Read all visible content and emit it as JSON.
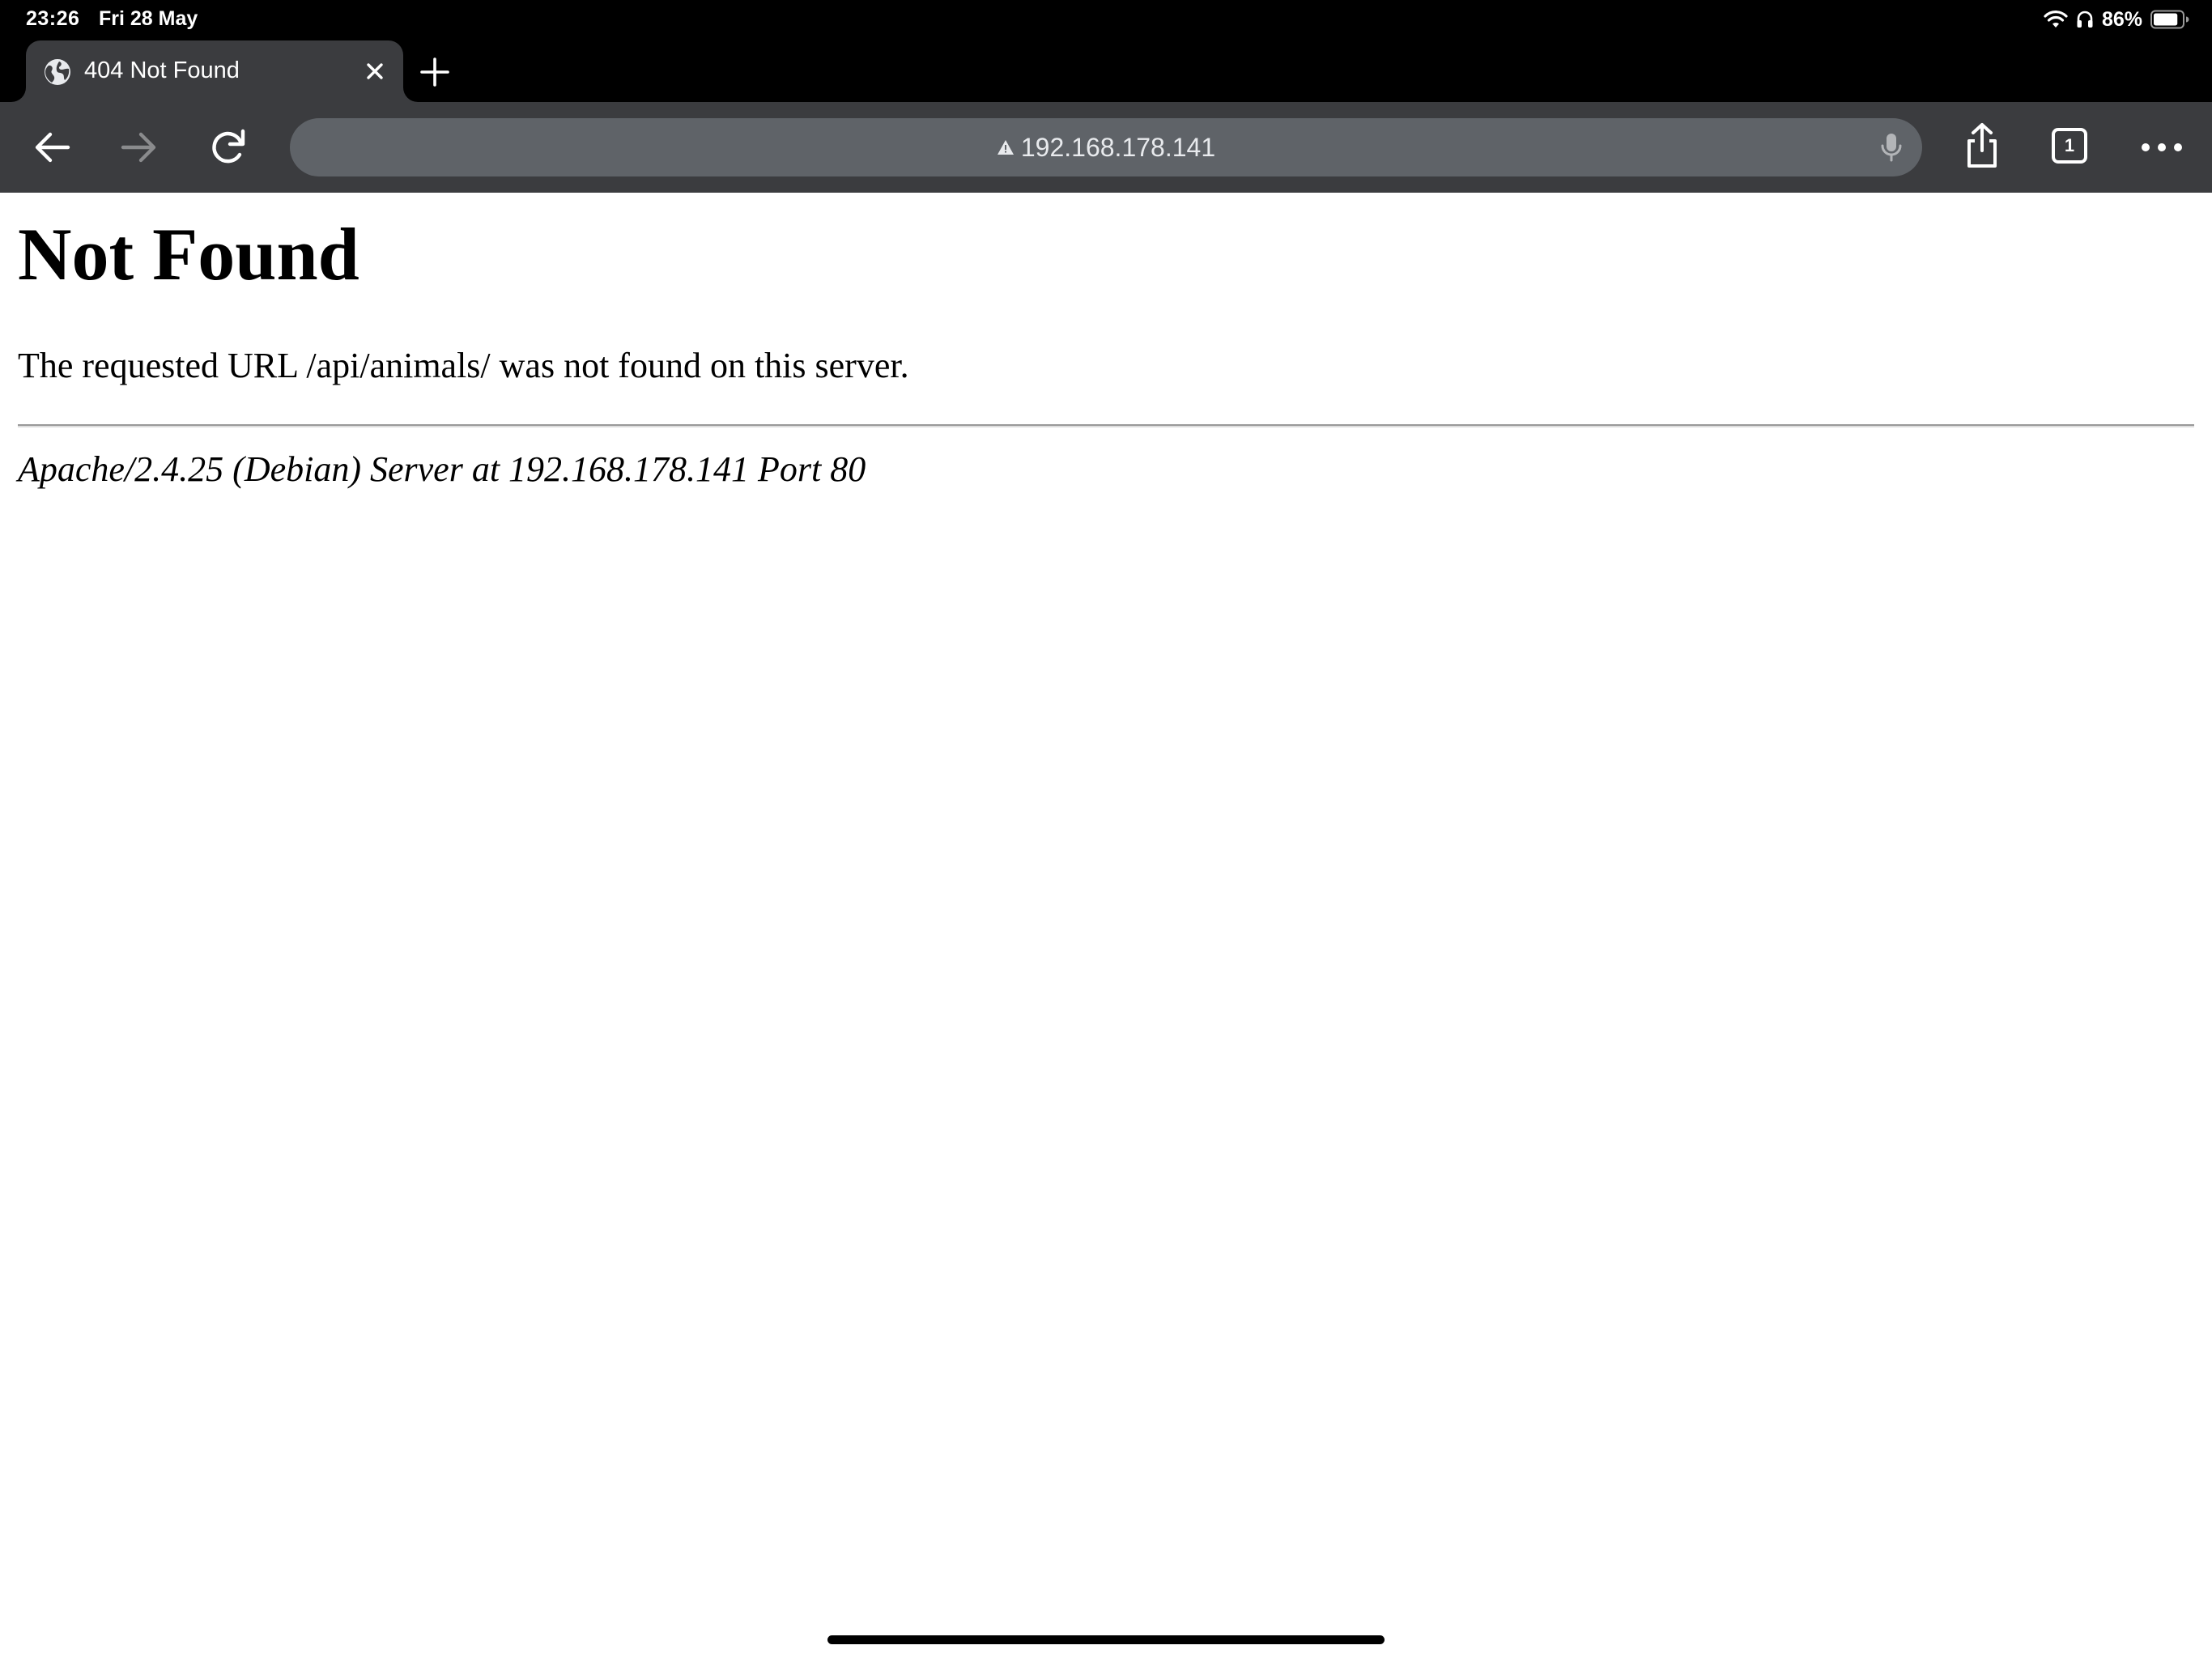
{
  "status_bar": {
    "time": "23:26",
    "date": "Fri 28 May",
    "battery_percent": "86%",
    "battery_level": 0.86,
    "icons": [
      "wifi-icon",
      "headphones-icon",
      "battery-icon"
    ]
  },
  "tabs": [
    {
      "title": "404 Not Found",
      "favicon": "globe-icon",
      "active": true
    }
  ],
  "toolbar": {
    "back_icon": "arrow-left-icon",
    "forward_icon": "arrow-right-icon",
    "reload_icon": "reload-icon",
    "share_icon": "share-icon",
    "menu_icon": "more-horizontal-icon",
    "tab_count": "1"
  },
  "address_bar": {
    "security_icon": "warning-icon",
    "url": "192.168.178.141",
    "mic_icon": "mic-icon"
  },
  "page": {
    "heading": "Not Found",
    "message": "The requested URL /api/animals/ was not found on this server.",
    "server_signature": "Apache/2.4.25 (Debian) Server at 192.168.178.141 Port 80"
  },
  "colors": {
    "chrome_dark": "#000000",
    "toolbar": "#3b3c3f",
    "omnibox": "#5f6368",
    "icon_active": "#ffffff",
    "icon_disabled": "#8a8b8d",
    "page_background": "#ffffff",
    "page_text": "#000000"
  }
}
